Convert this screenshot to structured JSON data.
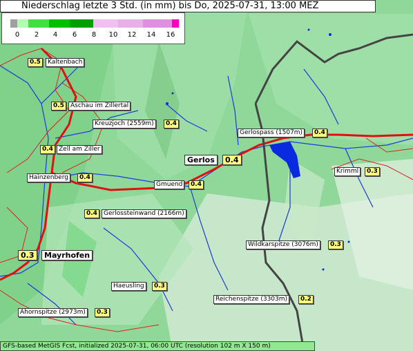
{
  "title": "Niederschlag letzte 3 Std. (in mm) bis Do, 2025-07-31, 13:00 MEZ",
  "legend": {
    "ticks": [
      "0",
      "2",
      "4",
      "6",
      "8",
      "10",
      "12",
      "14",
      "16"
    ],
    "colors": [
      "#a0a0a0",
      "#b0ffb0",
      "#40e040",
      "#00c000",
      "#008000",
      "#f0c0f0",
      "#e090e0",
      "#d060d0",
      "#ff00c0"
    ]
  },
  "places": [
    {
      "name": "Kaltenbach",
      "value": "0.5",
      "big": false
    },
    {
      "name": "Aschau im Zillertal",
      "value": "0.5",
      "big": false
    },
    {
      "name": "Kreuzjoch (2559m)",
      "value": "0.4",
      "big": false
    },
    {
      "name": "Gerlospass (1507m)",
      "value": "0.4",
      "big": false
    },
    {
      "name": "Zell am Ziller",
      "value": "0.4",
      "big": false
    },
    {
      "name": "Gerlos",
      "value": "0.4",
      "big": true
    },
    {
      "name": "Krimml",
      "value": "0.3",
      "big": false
    },
    {
      "name": "Hainzenberg",
      "value": "0.4",
      "big": false
    },
    {
      "name": "Gmuend",
      "value": "0.4",
      "big": false
    },
    {
      "name": "Gerlossteinwand (2166m)",
      "value": "0.4",
      "big": false
    },
    {
      "name": "Mayrhofen",
      "value": "0.3",
      "big": true
    },
    {
      "name": "Wildkarspitze (3076m)",
      "value": "0.3",
      "big": false
    },
    {
      "name": "Haeusling",
      "value": "0.3",
      "big": false
    },
    {
      "name": "Reichenspitze (3303m)",
      "value": "0.2",
      "big": false
    },
    {
      "name": "Ahornspitze (2973m)",
      "value": "0.3",
      "big": false
    }
  ],
  "footer": "GFS-based MetGIS Fcst, initialized 2025-07-31, 06:00 UTC  (resolution 102 m X 150 m)"
}
